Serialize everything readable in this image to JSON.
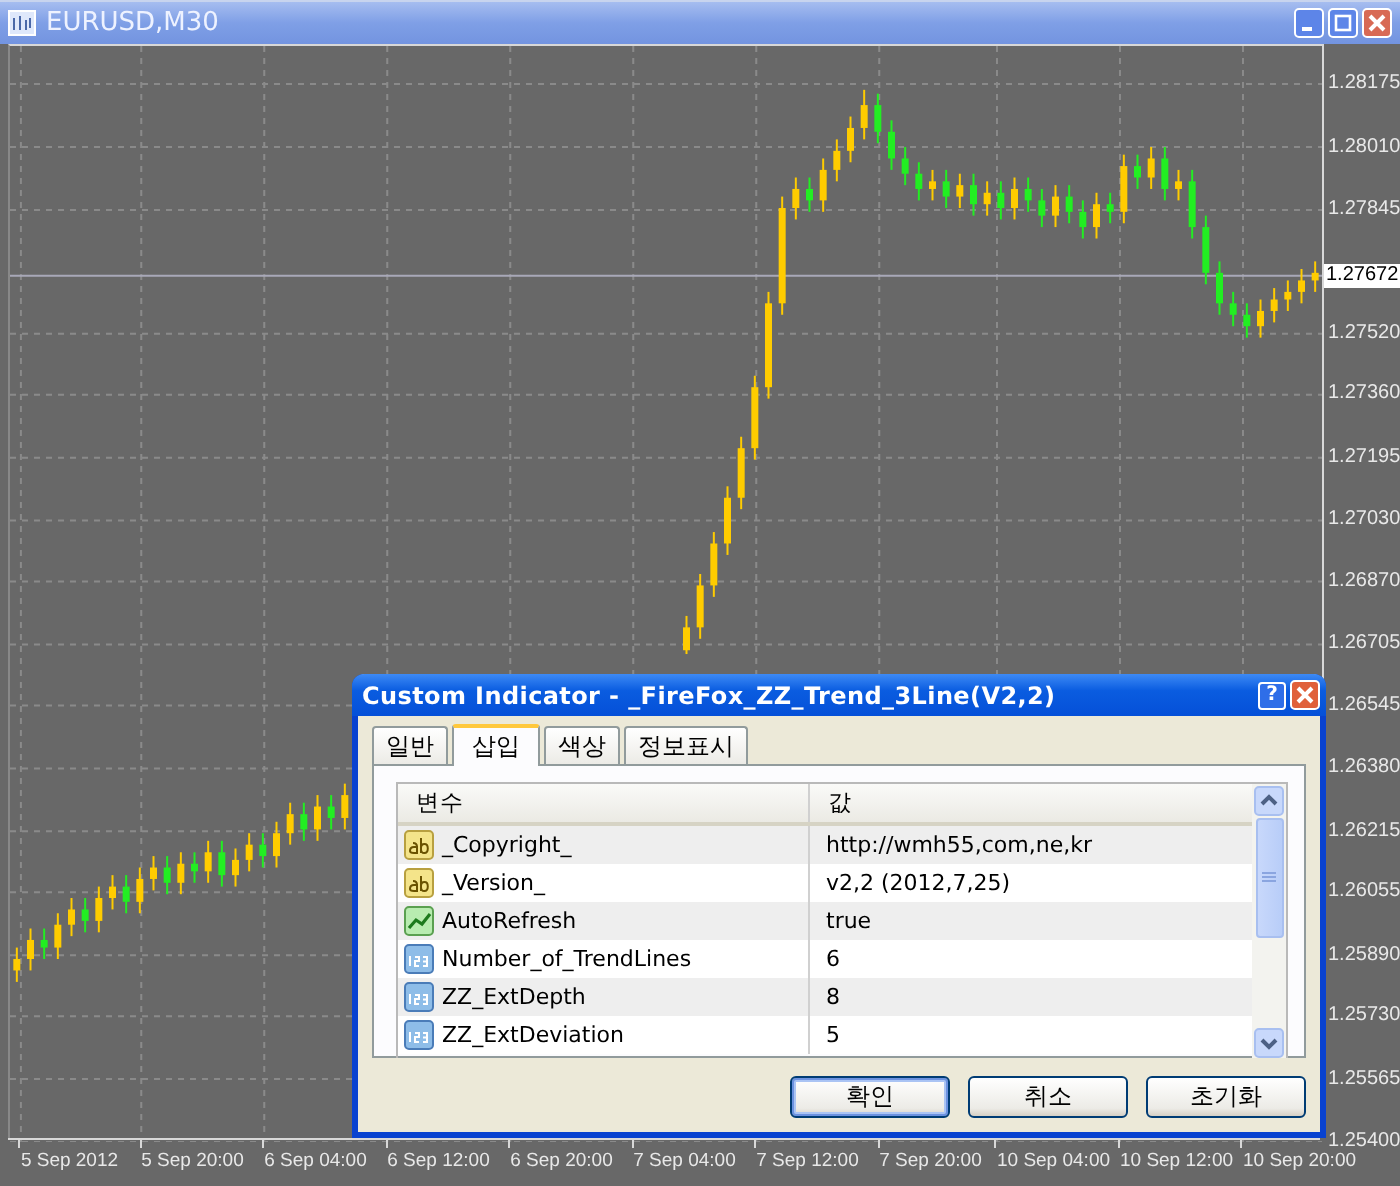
{
  "window": {
    "title": "EURUSD,M30"
  },
  "chart": {
    "chart_data": {
      "type": "candlestick",
      "ylim": [
        1.254,
        1.28275
      ],
      "yticks": [
        {
          "value": 1.28175,
          "label": "1.28175"
        },
        {
          "value": 1.2801,
          "label": "1.28010"
        },
        {
          "value": 1.27845,
          "label": "1.27845"
        },
        {
          "value": 1.2752,
          "label": "1.27520"
        },
        {
          "value": 1.2736,
          "label": "1.27360"
        },
        {
          "value": 1.27195,
          "label": "1.27195"
        },
        {
          "value": 1.2703,
          "label": "1.27030"
        },
        {
          "value": 1.2687,
          "label": "1.26870"
        },
        {
          "value": 1.26705,
          "label": "1.26705"
        },
        {
          "value": 1.26545,
          "label": "1.26545"
        },
        {
          "value": 1.2638,
          "label": "1.26380"
        },
        {
          "value": 1.26215,
          "label": "1.26215"
        },
        {
          "value": 1.26055,
          "label": "1.26055"
        },
        {
          "value": 1.2589,
          "label": "1.25890"
        },
        {
          "value": 1.2573,
          "label": "1.25730"
        },
        {
          "value": 1.25565,
          "label": "1.25565"
        },
        {
          "value": 1.254,
          "label": "1.25400"
        }
      ],
      "categories": [
        null,
        null,
        null,
        null,
        "5 Sep 2012",
        null,
        null,
        null,
        null,
        null,
        null,
        null,
        null,
        "5 Sep 20:00",
        null,
        null,
        null,
        null,
        null,
        null,
        null,
        null,
        "6 Sep 04:00",
        null,
        null,
        null,
        null,
        null,
        null,
        null,
        null,
        "6 Sep 12:00",
        null,
        null,
        null,
        null,
        null,
        null,
        null,
        null,
        "6 Sep 20:00",
        null,
        null,
        null,
        null,
        null,
        null,
        null,
        null,
        "7 Sep 04:00",
        null,
        null,
        null,
        null,
        null,
        null,
        null,
        null,
        "7 Sep 12:00",
        null,
        null,
        null,
        null,
        null,
        null,
        null,
        null,
        "7 Sep 20:00",
        null,
        null,
        null,
        null,
        null,
        null,
        null,
        null,
        "10 Sep 04:00",
        null,
        null,
        null,
        null,
        null,
        null,
        null,
        null,
        "10 Sep 12:00",
        null,
        null,
        null,
        null,
        null,
        null,
        null,
        null,
        "10 Sep 20:00",
        null
      ],
      "ref_lines": [
        {
          "axis": "y",
          "value": 1.27672,
          "label": "1.27672",
          "color": "#a8a8b8"
        }
      ],
      "grid": true,
      "ohlc": [
        [
          1.2585,
          1.2591,
          1.2582,
          1.2588
        ],
        [
          1.2588,
          1.2596,
          1.2585,
          1.2593
        ],
        [
          1.2593,
          1.2596,
          1.2588,
          1.2591
        ],
        [
          1.2591,
          1.26,
          1.2588,
          1.2597
        ],
        [
          1.2597,
          1.2604,
          1.2594,
          1.2601
        ],
        [
          1.2601,
          1.2604,
          1.2595,
          1.2598
        ],
        [
          1.2598,
          1.2607,
          1.2595,
          1.2604
        ],
        [
          1.2604,
          1.261,
          1.2601,
          1.2607
        ],
        [
          1.2607,
          1.261,
          1.26,
          1.2603
        ],
        [
          1.2603,
          1.2612,
          1.26,
          1.2609
        ],
        [
          1.2609,
          1.2615,
          1.2606,
          1.2612
        ],
        [
          1.2612,
          1.2615,
          1.2605,
          1.2608
        ],
        [
          1.2608,
          1.2616,
          1.2605,
          1.2613
        ],
        [
          1.2613,
          1.2616,
          1.2608,
          1.2611
        ],
        [
          1.2611,
          1.2619,
          1.2608,
          1.2616
        ],
        [
          1.2616,
          1.2619,
          1.2607,
          1.261
        ],
        [
          1.261,
          1.2617,
          1.2607,
          1.2614
        ],
        [
          1.2614,
          1.2621,
          1.2611,
          1.2618
        ],
        [
          1.2618,
          1.2621,
          1.2612,
          1.2615
        ],
        [
          1.2615,
          1.2624,
          1.2612,
          1.2621
        ],
        [
          1.2621,
          1.2629,
          1.2618,
          1.2626
        ],
        [
          1.2626,
          1.2629,
          1.2619,
          1.2622
        ],
        [
          1.2622,
          1.2631,
          1.2619,
          1.2628
        ],
        [
          1.2628,
          1.2631,
          1.2622,
          1.2625
        ],
        [
          1.2625,
          1.2634,
          1.2622,
          1.2631
        ],
        null,
        null,
        null,
        null,
        null,
        null,
        null,
        null,
        null,
        null,
        null,
        null,
        null,
        null,
        null,
        null,
        null,
        null,
        null,
        null,
        null,
        null,
        null,
        null,
        [
          1.2669,
          1.2678,
          1.2668,
          1.2675
        ],
        [
          1.2675,
          1.2689,
          1.2672,
          1.2686
        ],
        [
          1.2686,
          1.27,
          1.2683,
          1.2697
        ],
        [
          1.2697,
          1.2712,
          1.2694,
          1.2709
        ],
        [
          1.2709,
          1.2725,
          1.2706,
          1.2722
        ],
        [
          1.2722,
          1.2741,
          1.2719,
          1.2738
        ],
        [
          1.2738,
          1.2763,
          1.2735,
          1.276
        ],
        [
          1.276,
          1.2788,
          1.2757,
          1.2785
        ],
        [
          1.2785,
          1.2793,
          1.2782,
          1.279
        ],
        [
          1.279,
          1.2793,
          1.2784,
          1.2787
        ],
        [
          1.2787,
          1.2798,
          1.2784,
          1.2795
        ],
        [
          1.2795,
          1.2803,
          1.2792,
          1.28
        ],
        [
          1.28,
          1.2809,
          1.2797,
          1.2806
        ],
        [
          1.2806,
          1.2816,
          1.2803,
          1.2812
        ],
        [
          1.2812,
          1.2815,
          1.2802,
          1.2805
        ],
        [
          1.2805,
          1.2808,
          1.2795,
          1.2798
        ],
        [
          1.2798,
          1.2801,
          1.2791,
          1.2794
        ],
        [
          1.2794,
          1.2797,
          1.2787,
          1.279
        ],
        [
          1.279,
          1.2795,
          1.2787,
          1.2792
        ],
        [
          1.2792,
          1.2795,
          1.2785,
          1.2788
        ],
        [
          1.2788,
          1.2794,
          1.2785,
          1.2791
        ],
        [
          1.2791,
          1.2794,
          1.2783,
          1.2786
        ],
        [
          1.2786,
          1.2792,
          1.2783,
          1.2789
        ],
        [
          1.2789,
          1.2792,
          1.2782,
          1.2785
        ],
        [
          1.2785,
          1.2793,
          1.2782,
          1.279
        ],
        [
          1.279,
          1.2793,
          1.2784,
          1.2787
        ],
        [
          1.2787,
          1.279,
          1.278,
          1.2783
        ],
        [
          1.2783,
          1.2791,
          1.278,
          1.2788
        ],
        [
          1.2788,
          1.2791,
          1.2781,
          1.2784
        ],
        [
          1.2784,
          1.2787,
          1.2777,
          1.278
        ],
        [
          1.278,
          1.2789,
          1.2777,
          1.2786
        ],
        [
          1.2786,
          1.2789,
          1.2781,
          1.2784
        ],
        [
          1.2784,
          1.2799,
          1.2781,
          1.2796
        ],
        [
          1.2796,
          1.2799,
          1.279,
          1.2793
        ],
        [
          1.2793,
          1.2801,
          1.279,
          1.2798
        ],
        [
          1.2798,
          1.2801,
          1.2787,
          1.279
        ],
        [
          1.279,
          1.2795,
          1.2787,
          1.2792
        ],
        [
          1.2792,
          1.2795,
          1.2777,
          1.278
        ],
        [
          1.278,
          1.2783,
          1.2765,
          1.2768
        ],
        [
          1.2768,
          1.2771,
          1.2757,
          1.276
        ],
        [
          1.276,
          1.2763,
          1.2754,
          1.2757
        ],
        [
          1.2757,
          1.276,
          1.2751,
          1.2754
        ],
        [
          1.2754,
          1.2761,
          1.2751,
          1.2758
        ],
        [
          1.2758,
          1.2764,
          1.2755,
          1.2761
        ],
        [
          1.2761,
          1.2766,
          1.2758,
          1.2763
        ],
        [
          1.2763,
          1.2769,
          1.276,
          1.2766
        ],
        [
          1.2766,
          1.2771,
          1.2763,
          1.2768
        ]
      ]
    }
  },
  "dialog": {
    "title": "Custom Indicator - _FireFox_ZZ_Trend_3Line(V2,2)",
    "help_button": "?",
    "tabs": [
      {
        "label": "일반",
        "selected": false
      },
      {
        "label": "삽입",
        "selected": true
      },
      {
        "label": "색상",
        "selected": false
      },
      {
        "label": "정보표시",
        "selected": false
      }
    ],
    "table": {
      "columns": [
        "변수",
        "값"
      ],
      "rows": [
        {
          "kind": "string",
          "name": "_Copyright_",
          "value": "http://wmh55,com,ne,kr"
        },
        {
          "kind": "string",
          "name": "_Version_",
          "value": "v2,2 (2012,7,25)"
        },
        {
          "kind": "bool",
          "name": "AutoRefresh",
          "value": "true"
        },
        {
          "kind": "int",
          "name": "Number_of_TrendLines",
          "value": "6"
        },
        {
          "kind": "int",
          "name": "ZZ_ExtDepth",
          "value": "8"
        },
        {
          "kind": "int",
          "name": "ZZ_ExtDeviation",
          "value": "5"
        }
      ]
    },
    "buttons": [
      {
        "label": "확인",
        "default": true
      },
      {
        "label": "취소",
        "default": false
      },
      {
        "label": "초기화",
        "default": false
      }
    ]
  }
}
